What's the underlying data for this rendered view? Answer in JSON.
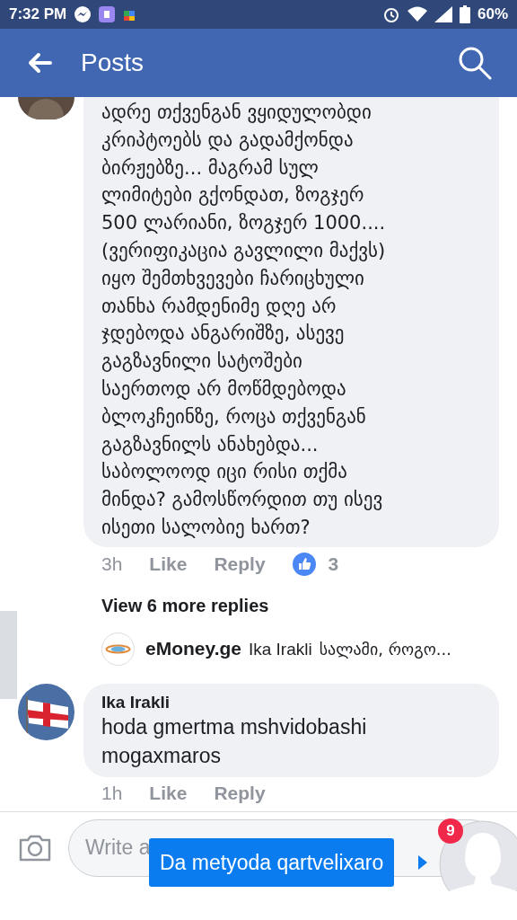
{
  "status_bar": {
    "time": "7:32 PM",
    "battery": "60%"
  },
  "app_bar": {
    "title": "Posts"
  },
  "comments": [
    {
      "kind": "cut",
      "text": "ადრე თქვენგან ვყიდულობდი\nკრიპტოებს და გადამქონდა\nბირჟებზე... მაგრამ სულ\nლიმიტები გქონდათ, ზოგჯერ\n500 ლარიანი, ზოგჯერ 1000....\n(ვერიფიკაცია გავლილი მაქვს)\nიყო შემთხვევები ჩარიცხული\nთანხა რამდენიმე დღე არ\nჯდებოდა ანგარიშზე, ასევე\nგაგზავნილი სატოშები\nსაერთოდ არ მოწმდებოდა\nბლოკჩეინზე, როცა თქვენგან\nგაგზავნილს ანახებდა...\nსაბოლოოდ იცი რისი თქმა\nმინდა? გამოსწორდით თუ ისევ\nისეთი სალობიე ხართ?",
      "time": "3h",
      "like": "Like",
      "reply": "Reply",
      "reactions": "3",
      "more_replies": "View 6 more replies",
      "reply_preview": {
        "author": "eMoney.ge",
        "mention": "Ika Irakli",
        "text": "სალამი, როგო..."
      }
    },
    {
      "kind": "full",
      "author": "Ika Irakli",
      "text": "hoda gmertma mshvidobashi\nmogaxmaros",
      "time": "1h",
      "like": "Like",
      "reply": "Reply"
    }
  ],
  "composer": {
    "placeholder": "Write a"
  },
  "chat_head": {
    "badge": "9",
    "message": "Da metyoda qartvelixaro"
  }
}
